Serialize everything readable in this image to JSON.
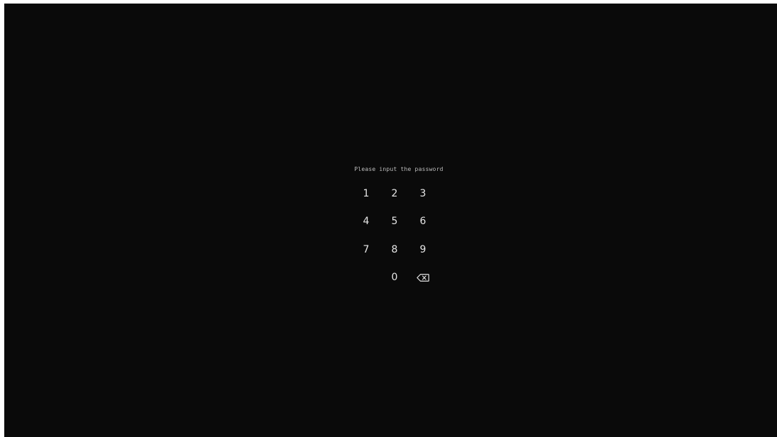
{
  "prompt": "Please input the password",
  "keypad": {
    "keys": [
      "1",
      "2",
      "3",
      "4",
      "5",
      "6",
      "7",
      "8",
      "9",
      "0"
    ],
    "backspace_icon": "backspace-icon"
  },
  "colors": {
    "background": "#0a0a0a",
    "text": "#e6e6e6"
  }
}
